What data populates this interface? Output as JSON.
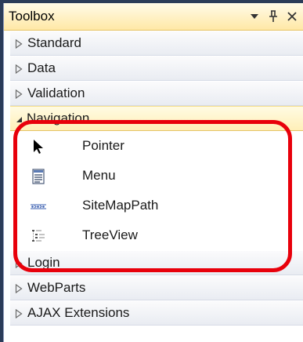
{
  "window": {
    "title": "Toolbox",
    "controls": [
      "dropdown-arrow-icon",
      "pin-icon",
      "close-icon"
    ]
  },
  "groups_before": [
    {
      "label": "Standard",
      "expanded": false
    },
    {
      "label": "Data",
      "expanded": false
    },
    {
      "label": "Validation",
      "expanded": false
    }
  ],
  "navigation": {
    "label": "Navigation",
    "expanded": true,
    "items": [
      {
        "label": "Pointer",
        "icon": "pointer-arrow-icon"
      },
      {
        "label": "Menu",
        "icon": "menu-icon"
      },
      {
        "label": "SiteMapPath",
        "icon": "sitemappath-icon"
      },
      {
        "label": "TreeView",
        "icon": "treeview-icon"
      }
    ]
  },
  "groups_after": [
    {
      "label": "Login",
      "expanded": false
    },
    {
      "label": "WebParts",
      "expanded": false
    },
    {
      "label": "AJAX Extensions",
      "expanded": false
    }
  ],
  "colors": {
    "highlight": "#e8000b",
    "titlebar": "#ffe8a6",
    "frame": "#2b3c59"
  }
}
